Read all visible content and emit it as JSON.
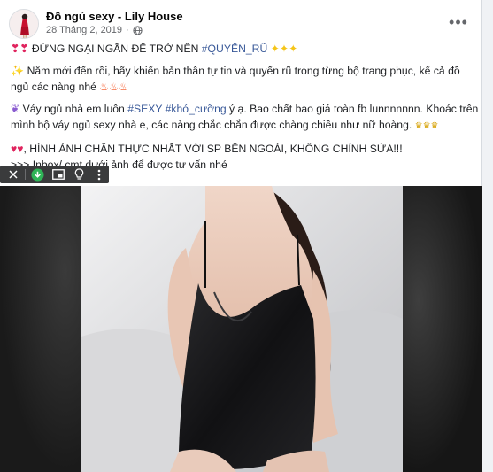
{
  "post": {
    "page_name": "Đồ ngủ sexy - Lily House",
    "date": "28 Tháng 2, 2019",
    "more_label": "•••",
    "lines": {
      "l1_prefix": "ĐỪNG NGẠI NGẦN ĐỂ TRỞ NÊN ",
      "l1_hashtag": "#QUYẾN_RŨ",
      "l2": "Năm mới đến rồi, hãy khiến bản thân tự tin và quyến rũ trong từng bộ trang phục, kể cả đồ",
      "l3": "ngủ các nàng nhé",
      "l4_prefix": "Váy ngủ nhà em luôn ",
      "l4_hashtag1": "#SEXY",
      "l4_hashtag2": "#khó_cưỡng",
      "l4_suffix": " ý ạ. Bao chất bao giá toàn fb lunnnnnnn. Khoác trên",
      "l5": "mình bộ váy ngủ sexy nhà e, các nàng chắc chắn được chàng chiều như nữ hoàng.",
      "l6": ", HÌNH ẢNH CHÂN THỰC NHẤT VỚI SP BÊN NGOÀI, KHÔNG CHỈNH SỬA!!!",
      "l7": ">>> Inbox/ cmt dưới ảnh để được tư vấn nhé"
    }
  },
  "icons": {
    "globe": "globe-icon",
    "close": "close-icon",
    "download": "download-icon",
    "pip": "picture-in-picture-icon",
    "bulb": "lightbulb-icon",
    "more": "vertical-dots-icon"
  },
  "colors": {
    "hashtag": "#385898",
    "meta": "#65676b",
    "toolbar": "#3a3b3c",
    "download_green": "#2fb457"
  }
}
